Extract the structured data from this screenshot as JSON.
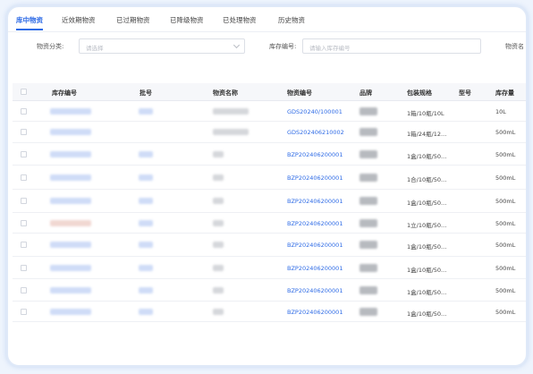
{
  "tabs": [
    {
      "label": "库中物资",
      "active": true
    },
    {
      "label": "近效期物资",
      "active": false
    },
    {
      "label": "已过期物资",
      "active": false
    },
    {
      "label": "已降级物资",
      "active": false
    },
    {
      "label": "已处理物资",
      "active": false
    },
    {
      "label": "历史物资",
      "active": false
    }
  ],
  "filters": {
    "category_label": "物资分类:",
    "category_placeholder": "请选择",
    "stock_no_label": "库存编号:",
    "stock_no_placeholder": "请输入库存编号",
    "extra_label": "物资名"
  },
  "table": {
    "columns": [
      "库存编号",
      "批号",
      "物资名称",
      "物资编号",
      "品牌",
      "包装规格",
      "型号",
      "库存量"
    ],
    "rows": [
      {
        "code": "GDS20240/100001",
        "spec": "1箱/10瓶/10L",
        "qty": "10L"
      },
      {
        "code": "GDS202406210002",
        "spec": "1箱/24瓶/12...",
        "qty": "500mL"
      },
      {
        "code": "BZP202406200001",
        "spec": "1盒/10瓶/50...",
        "qty": "500mL"
      },
      {
        "code": "BZP202406200001",
        "spec": "1合/10瓶/50...",
        "qty": "500mL"
      },
      {
        "code": "BZP202406200001",
        "spec": "1盒/10瓶/50...",
        "qty": "500mL"
      },
      {
        "code": "BZP202406200001",
        "spec": "1立/10瓶/50...",
        "qty": "500mL"
      },
      {
        "code": "BZP202406200001",
        "spec": "1盒/10瓶/50...",
        "qty": "500mL"
      },
      {
        "code": "BZP202406200001",
        "spec": "1盒/10瓶/50...",
        "qty": "500mL"
      },
      {
        "code": "BZP202406200001",
        "spec": "1盒/10瓶/50...",
        "qty": "500mL"
      },
      {
        "code": "BZP202406200001",
        "spec": "1盒/10瓶/50...",
        "qty": "500mL"
      }
    ]
  },
  "colors": {
    "accent": "#2e6be6",
    "header_bg": "#f6f7fa",
    "frame_bg": "#eef4fd"
  }
}
